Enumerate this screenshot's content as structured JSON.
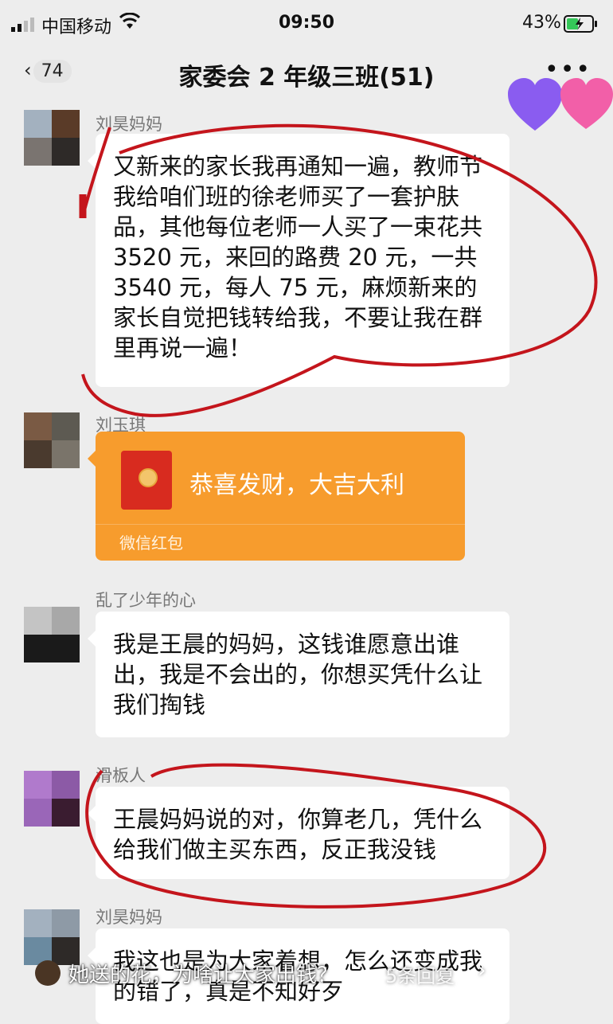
{
  "status_bar": {
    "carrier": "中国移动",
    "time": "09:50",
    "battery": "43%"
  },
  "chat": {
    "back_badge": "74",
    "title": "家委会 2 年级三班(51)",
    "more": "•••"
  },
  "messages": [
    {
      "sender": "刘昊妈妈",
      "text": "又新来的家长我再通知一遍，教师节我给咱们班的徐老师买了一套护肤品，其他每位老师一人买了一束花共 3520 元，来回的路费 20 元，一共 3540 元，每人 75 元，麻烦新来的家长自觉把钱转给我，不要让我在群里再说一遍！"
    },
    {
      "sender": "刘玉琪",
      "red_packet_text": "恭喜发财，大吉大利",
      "red_packet_label": "微信红包"
    },
    {
      "sender": "乱了少年的心",
      "text": "我是王晨的妈妈，这钱谁愿意出谁出，我是不会出的，你想买凭什么让我们掏钱"
    },
    {
      "sender": "滑板人",
      "text": "王晨妈妈说的对，你算老几，凭什么给我们做主买东西，反正我没钱"
    },
    {
      "sender": "刘昊妈妈",
      "text": "我这也是为大家着想，怎么还变成我的错了，真是不知好歹"
    }
  ],
  "footer": {
    "caption": "她送的花，为啥让大家出钱？",
    "replies": "5条回复",
    "arrow": "›"
  },
  "colors": {
    "background": "#ededed",
    "bubble": "#ffffff",
    "red_packet": "#f79c2d",
    "annotation_red": "#c4151c"
  }
}
